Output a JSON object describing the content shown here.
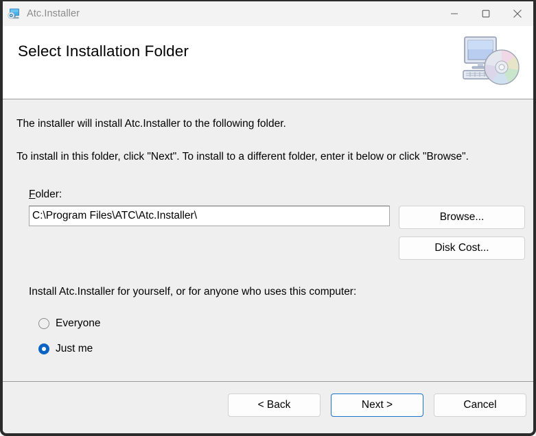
{
  "window": {
    "title": "Atc.Installer",
    "icon": "computer-disc-icon",
    "controls": {
      "minimize": "minimize-icon",
      "maximize": "maximize-icon",
      "close": "close-icon"
    }
  },
  "header": {
    "title": "Select Installation Folder",
    "icon": "computer-cd-installer-icon"
  },
  "body": {
    "intro_text": "The installer will install Atc.Installer to the following folder.",
    "instruction_text": "To install in this folder, click \"Next\". To install to a different folder, enter it below or click \"Browse\".",
    "folder_label_accel": "F",
    "folder_label_rest": "older:",
    "folder_value": "C:\\Program Files\\ATC\\Atc.Installer\\",
    "folder_placeholder": "",
    "browse_label": "Browse...",
    "disk_cost_label": "Disk Cost...",
    "scope_question": "Install Atc.Installer for yourself, or for anyone who uses this computer:",
    "radio_options": [
      {
        "label": "Everyone",
        "selected": false
      },
      {
        "label": "Just me",
        "selected": true
      }
    ]
  },
  "footer": {
    "back_label": "< Back",
    "next_label": "Next >",
    "cancel_label": "Cancel"
  },
  "colors": {
    "accent": "#0b63c5",
    "default_button_border": "#1a74cf",
    "window_background": "#efefef",
    "header_background": "#ffffff",
    "titlebar_background": "#f3f3f3",
    "title_text": "#8b8b8b"
  }
}
